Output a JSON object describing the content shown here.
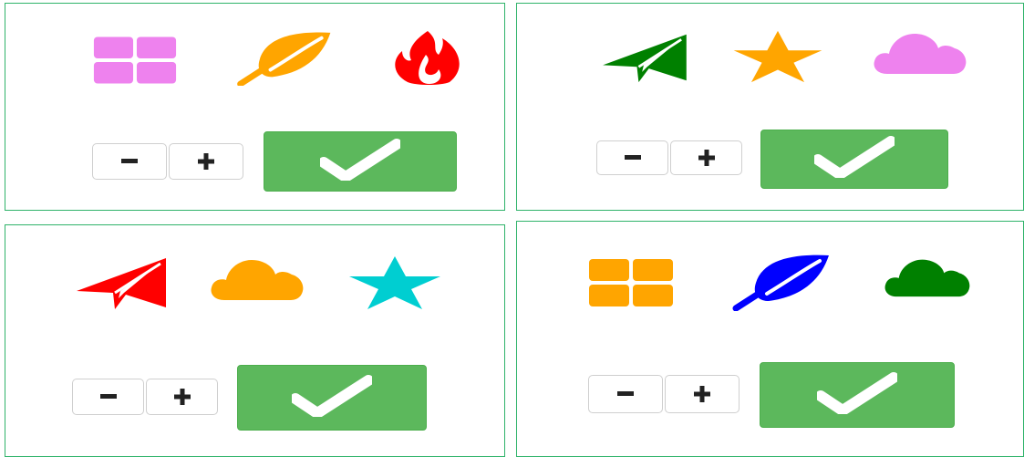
{
  "panels": [
    {
      "icons": [
        {
          "name": "grid-icon",
          "color": "#ee82ee"
        },
        {
          "name": "leaf-icon",
          "color": "#ffa500"
        },
        {
          "name": "fire-icon",
          "color": "#ff0000"
        }
      ],
      "stepper": {
        "decrement_glyph": "minus-icon",
        "increment_glyph": "plus-icon"
      },
      "confirm": {
        "glyph": "check-icon",
        "color": "#5cb85c"
      }
    },
    {
      "icons": [
        {
          "name": "paper-plane-icon",
          "color": "#008000"
        },
        {
          "name": "star-icon",
          "color": "#ffa500"
        },
        {
          "name": "cloud-icon",
          "color": "#ee82ee"
        }
      ],
      "stepper": {
        "decrement_glyph": "minus-icon",
        "increment_glyph": "plus-icon"
      },
      "confirm": {
        "glyph": "check-icon",
        "color": "#5cb85c"
      }
    },
    {
      "icons": [
        {
          "name": "paper-plane-icon",
          "color": "#ff0000"
        },
        {
          "name": "cloud-icon",
          "color": "#ffa500"
        },
        {
          "name": "star-icon",
          "color": "#00ced1"
        }
      ],
      "stepper": {
        "decrement_glyph": "minus-icon",
        "increment_glyph": "plus-icon"
      },
      "confirm": {
        "glyph": "check-icon",
        "color": "#5cb85c"
      }
    },
    {
      "icons": [
        {
          "name": "grid-icon",
          "color": "#ffa500"
        },
        {
          "name": "leaf-icon",
          "color": "#0000ff"
        },
        {
          "name": "cloud-icon",
          "color": "#008000"
        }
      ],
      "stepper": {
        "decrement_glyph": "minus-icon",
        "increment_glyph": "plus-icon"
      },
      "confirm": {
        "glyph": "check-icon",
        "color": "#5cb85c"
      }
    }
  ]
}
